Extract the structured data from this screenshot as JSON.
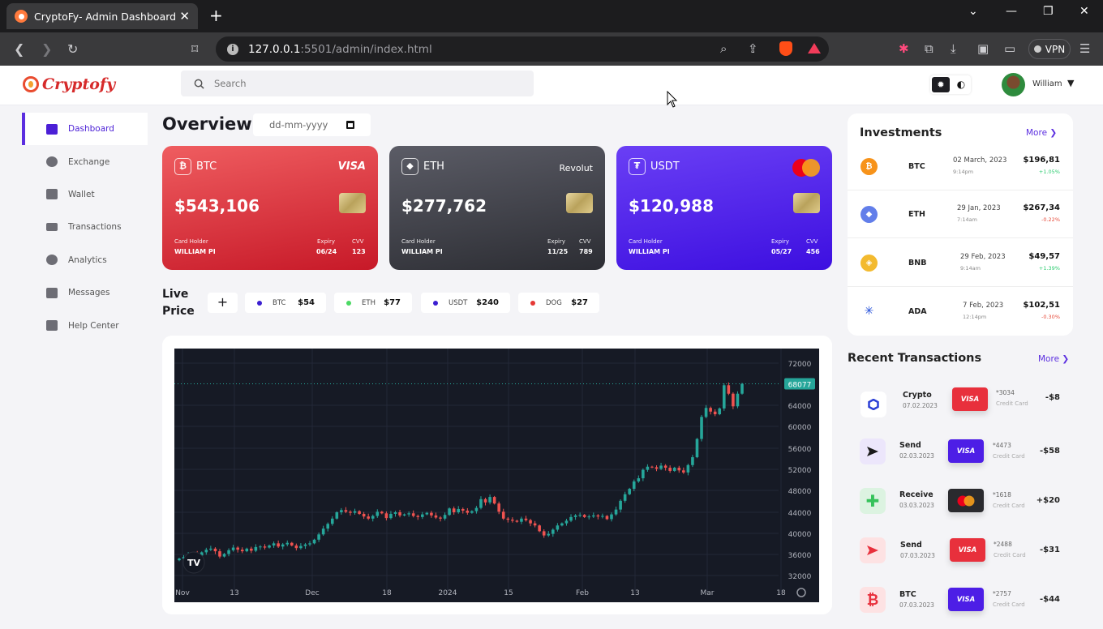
{
  "browser": {
    "tab_title": "CryptoFy- Admin Dashboard",
    "url_host": "127.0.0.1",
    "url_rest": ":5501/admin/index.html",
    "vpn_label": "VPN"
  },
  "header": {
    "logo_text": "Cryptofy",
    "search_placeholder": "Search",
    "user_name": "William"
  },
  "sidebar": {
    "items": [
      {
        "label": "Dashboard",
        "icon": "dashboard-icon"
      },
      {
        "label": "Exchange",
        "icon": "exchange-icon"
      },
      {
        "label": "Wallet",
        "icon": "wallet-icon"
      },
      {
        "label": "Transactions",
        "icon": "transactions-icon"
      },
      {
        "label": "Analytics",
        "icon": "analytics-icon"
      },
      {
        "label": "Messages",
        "icon": "messages-icon"
      },
      {
        "label": "Help Center",
        "icon": "help-icon"
      }
    ]
  },
  "overview": {
    "title": "Overview",
    "date_placeholder": "dd-mm-yyyy"
  },
  "cards": [
    {
      "coin": "BTC",
      "coin_glyph": "₿",
      "brand": "VISA",
      "amount": "$543,106",
      "holder_label": "Card Holder",
      "holder": "WILLIAM PI",
      "expiry_label": "Expiry",
      "expiry": "06/24",
      "cvv_label": "CVV",
      "cvv": "123",
      "color": "#e0353f"
    },
    {
      "coin": "ETH",
      "coin_glyph": "◆",
      "brand": "Revolut",
      "amount": "$277,762",
      "holder_label": "Card Holder",
      "holder": "WILLIAM PI",
      "expiry_label": "Expiry",
      "expiry": "11/25",
      "cvv_label": "CVV",
      "cvv": "789",
      "color": "#3c3d45"
    },
    {
      "coin": "USDT",
      "coin_glyph": "₮",
      "brand": "mastercard",
      "amount": "$120,988",
      "holder_label": "Card Holder",
      "holder": "WILLIAM PI",
      "expiry_label": "Expiry",
      "expiry": "05/27",
      "cvv_label": "CVV",
      "cvv": "456",
      "color": "#4f24ea"
    }
  ],
  "live_price": {
    "title": "Live Price",
    "add_label": "+",
    "items": [
      {
        "sym": "BTC",
        "price": "$54",
        "color": "#3b1fd1"
      },
      {
        "sym": "ETH",
        "price": "$77",
        "color": "#4cd964"
      },
      {
        "sym": "USDT",
        "price": "$240",
        "color": "#3b1fd1"
      },
      {
        "sym": "DOG",
        "price": "$27",
        "color": "#e53935"
      }
    ]
  },
  "chart_data": {
    "type": "candlestick",
    "y_ticks": [
      "72000",
      "64000",
      "60000",
      "56000",
      "52000",
      "48000",
      "44000",
      "40000",
      "36000",
      "32000"
    ],
    "x_ticks": [
      "Nov",
      "13",
      "Dec",
      "18",
      "2024",
      "15",
      "Feb",
      "13",
      "Mar",
      "18"
    ],
    "last_price_label": "68077",
    "ylim": [
      30000,
      74000
    ],
    "closes": [
      35200,
      35500,
      35900,
      36200,
      35800,
      36400,
      36900,
      37100,
      36600,
      35600,
      36100,
      36800,
      37300,
      36900,
      36600,
      37100,
      36700,
      37400,
      37500,
      37300,
      37700,
      38100,
      37500,
      37900,
      38200,
      37700,
      37200,
      37600,
      37900,
      38100,
      38800,
      39800,
      40900,
      41800,
      42800,
      44000,
      44400,
      44100,
      43900,
      44200,
      43700,
      43200,
      42800,
      43300,
      44100,
      43800,
      42900,
      43700,
      44000,
      43400,
      43600,
      43800,
      43300,
      43100,
      43600,
      43900,
      43400,
      43000,
      42800,
      43500,
      44700,
      44000,
      44600,
      44300,
      43900,
      44200,
      44800,
      46400,
      45800,
      46800,
      45600,
      44100,
      42800,
      42600,
      42400,
      42200,
      42800,
      42500,
      41900,
      41500,
      40400,
      39600,
      39900,
      40700,
      41500,
      41900,
      42400,
      43100,
      43400,
      43500,
      43100,
      43200,
      43400,
      43200,
      43300,
      42700,
      43600,
      44500,
      46100,
      47300,
      48300,
      49700,
      50300,
      51900,
      52500,
      52400,
      52100,
      52700,
      52300,
      51700,
      52300,
      51800,
      51400,
      52800,
      54300,
      57700,
      61800,
      63500,
      62800,
      62300,
      63400,
      67800,
      66200,
      63800,
      66200,
      68077
    ]
  },
  "investments": {
    "title": "Investments",
    "more": "More",
    "rows": [
      {
        "sym": "BTC",
        "glyph": "₿",
        "color": "#f7931a",
        "date": "02 March, 2023",
        "time": "9:14pm",
        "value": "$196,81",
        "change": "+1.05%",
        "up": true
      },
      {
        "sym": "ETH",
        "glyph": "◆",
        "color": "#627eea",
        "date": "29 Jan, 2023",
        "time": "7:14am",
        "value": "$267,34",
        "change": "-0.22%",
        "up": false
      },
      {
        "sym": "BNB",
        "glyph": "◈",
        "color": "#f3ba2f",
        "date": "29 Feb, 2023",
        "time": "9:14am",
        "value": "$49,57",
        "change": "+1.39%",
        "up": true
      },
      {
        "sym": "ADA",
        "glyph": "✳",
        "color": "#ffffff",
        "date": "7 Feb, 2023",
        "time": "12:14pm",
        "value": "$102,51",
        "change": "-0.30%",
        "up": false
      }
    ]
  },
  "recent": {
    "title": "Recent Transactions",
    "more": "More",
    "rows": [
      {
        "name": "Crypto",
        "date": "07.02.2023",
        "card": "VISA",
        "card_color": "#e8303c",
        "num": "*3034",
        "type": "Credit Card",
        "amount": "-$8",
        "icon": "crypto-hex-icon",
        "icon_bg": "#ffffff"
      },
      {
        "name": "Send",
        "date": "02.03.2023",
        "card": "VISA",
        "card_color": "#4d1ee6",
        "num": "*4473",
        "type": "Credit Card",
        "amount": "-$58",
        "icon": "send-icon",
        "icon_bg": "#ece6fb"
      },
      {
        "name": "Receive",
        "date": "03.03.2023",
        "card": "mastercard",
        "card_color": "#2a2a2e",
        "num": "*1618",
        "type": "Credit Card",
        "amount": "+$20",
        "icon": "receive-icon",
        "icon_bg": "#dcf3e1"
      },
      {
        "name": "Send",
        "date": "07.03.2023",
        "card": "VISA",
        "card_color": "#e8303c",
        "num": "*2488",
        "type": "Credit Card",
        "amount": "-$31",
        "icon": "send-red-icon",
        "icon_bg": "#fde2e3"
      },
      {
        "name": "BTC",
        "date": "07.03.2023",
        "card": "VISA",
        "card_color": "#4d1ee6",
        "num": "*2757",
        "type": "Credit Card",
        "amount": "-$44",
        "icon": "btc-exchange-icon",
        "icon_bg": "#fde2e3"
      }
    ]
  }
}
